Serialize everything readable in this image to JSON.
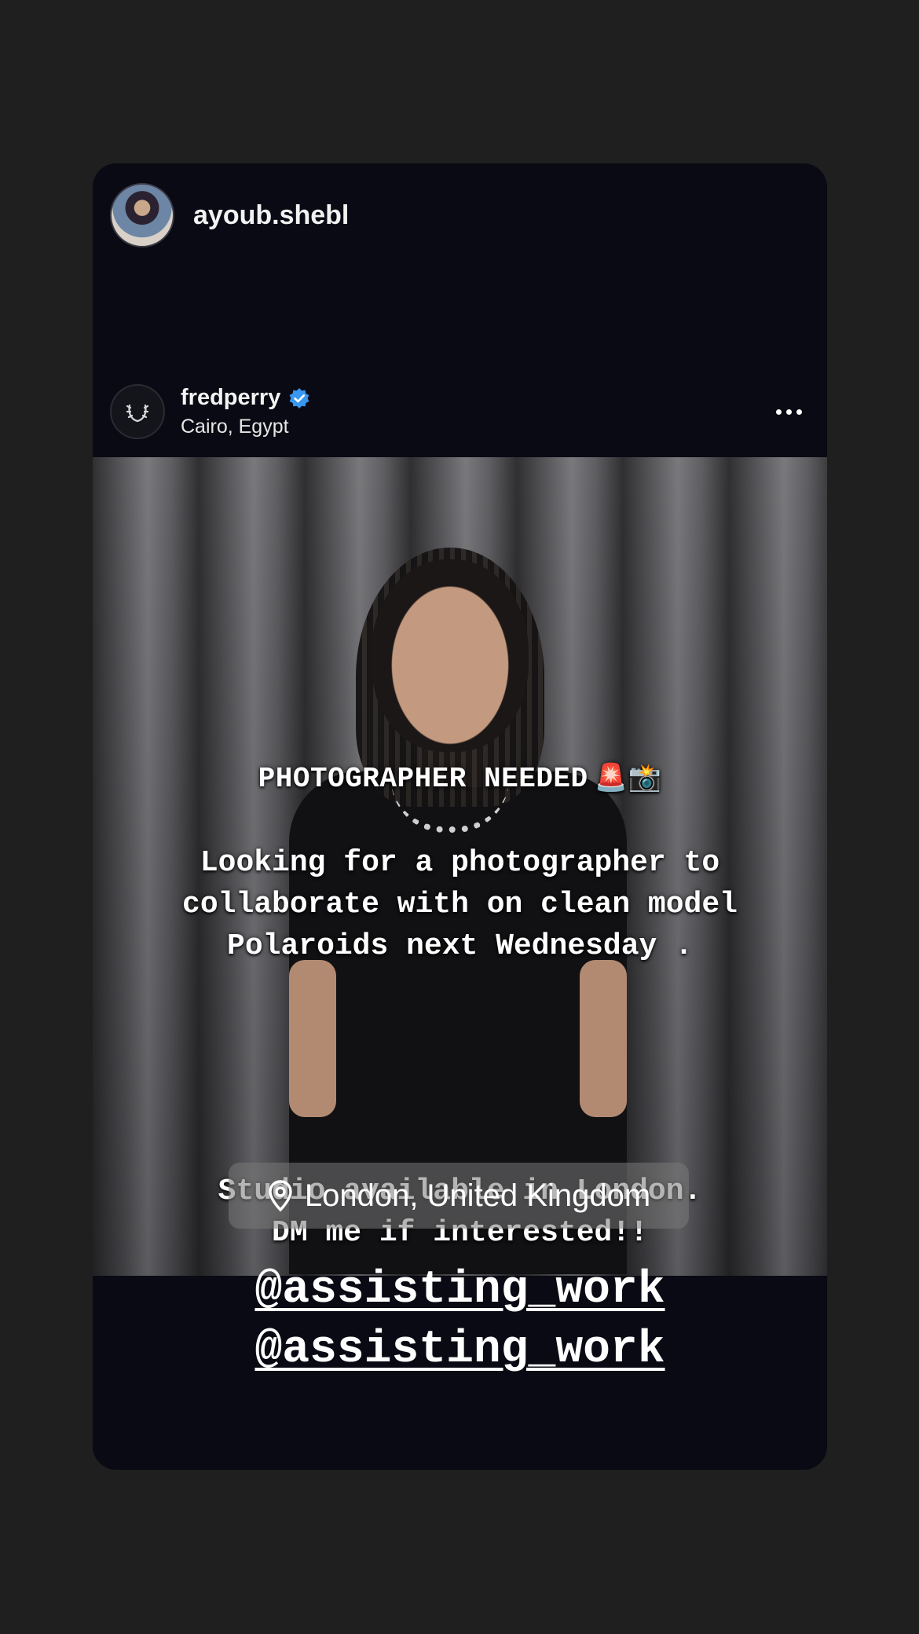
{
  "story": {
    "username": "ayoub.shebl"
  },
  "post": {
    "account": "fredperry",
    "location": "Cairo, Egypt",
    "verified": true,
    "verified_color": "#3897f0"
  },
  "overlay": {
    "headline": "PHOTOGRAPHER NEEDED",
    "headline_emoji": "🚨📸",
    "body_lines": [
      "Looking for a photographer to",
      "collaborate with on clean model",
      "Polaroids next Wednesday ."
    ],
    "body_lines2": [
      "Studio available in London.",
      "DM me if interested!!"
    ],
    "location_sticker": "London, United Kingdom",
    "mentions": [
      "@assisting_work",
      "@assisting_work"
    ]
  },
  "icons": {
    "more": "more-horizontal-icon",
    "verified": "verified-badge-icon",
    "location_pin": "location-pin-icon",
    "brand_logo": "laurel-wreath-icon"
  }
}
